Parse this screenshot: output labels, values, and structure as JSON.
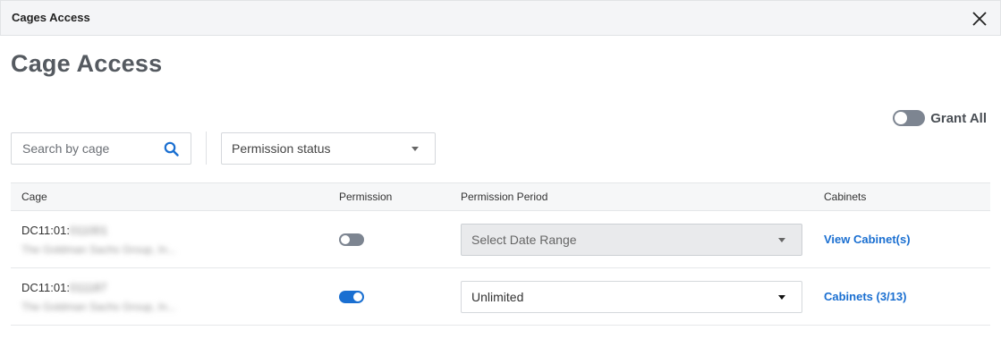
{
  "window": {
    "title": "Cages Access"
  },
  "page": {
    "heading": "Cage Access"
  },
  "toolbar": {
    "grant_all_label": "Grant All",
    "grant_all_on": false,
    "search_placeholder": "Search by cage",
    "search_icon": "search-icon",
    "permission_status_label": "Permission status"
  },
  "table": {
    "headers": {
      "cage": "Cage",
      "permission": "Permission",
      "period": "Permission Period",
      "cabinets": "Cabinets"
    },
    "rows": [
      {
        "cage_prefix": "DC11:01:",
        "cage_suffix": "011001",
        "org": "The Goldman Sachs Group, In...",
        "permission_on": false,
        "period": "Select Date Range",
        "period_disabled": true,
        "cabinets_link": "View Cabinet(s)"
      },
      {
        "cage_prefix": "DC11:01:",
        "cage_suffix": "011187",
        "org": "The Goldman Sachs Group, In...",
        "permission_on": true,
        "period": "Unlimited",
        "period_disabled": false,
        "cabinets_link": "Cabinets (3/13)"
      }
    ]
  },
  "colors": {
    "accent": "#1a6fd1",
    "toggle_off": "#7d8591",
    "heading": "#555a60"
  }
}
